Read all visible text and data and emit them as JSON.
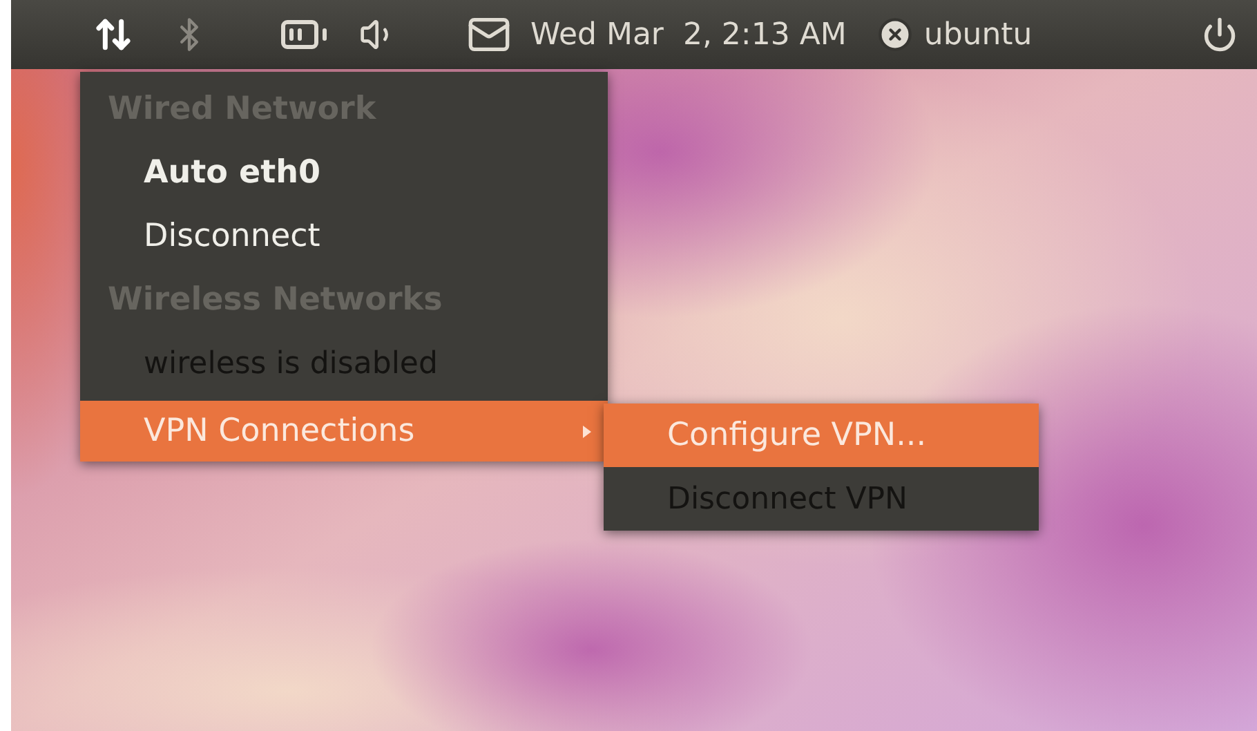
{
  "panel": {
    "clock": "Wed Mar  2, 2:13 AM",
    "user": "ubuntu"
  },
  "menu": {
    "items": [
      {
        "kind": "header",
        "label": "Wired Network"
      },
      {
        "kind": "item",
        "label": "Auto eth0",
        "bold": true,
        "selected": false
      },
      {
        "kind": "item",
        "label": "Disconnect",
        "bold": false,
        "selected": false
      },
      {
        "kind": "header",
        "label": "Wireless Networks"
      },
      {
        "kind": "disabled",
        "label": "wireless is disabled"
      },
      {
        "kind": "submenu",
        "label": "VPN Connections",
        "selected": true,
        "expanded": true
      }
    ]
  },
  "submenu": {
    "items": [
      {
        "kind": "item",
        "label": "Configure VPN...",
        "bold": false,
        "selected": true
      },
      {
        "kind": "disabled",
        "label": "Disconnect VPN"
      }
    ]
  }
}
